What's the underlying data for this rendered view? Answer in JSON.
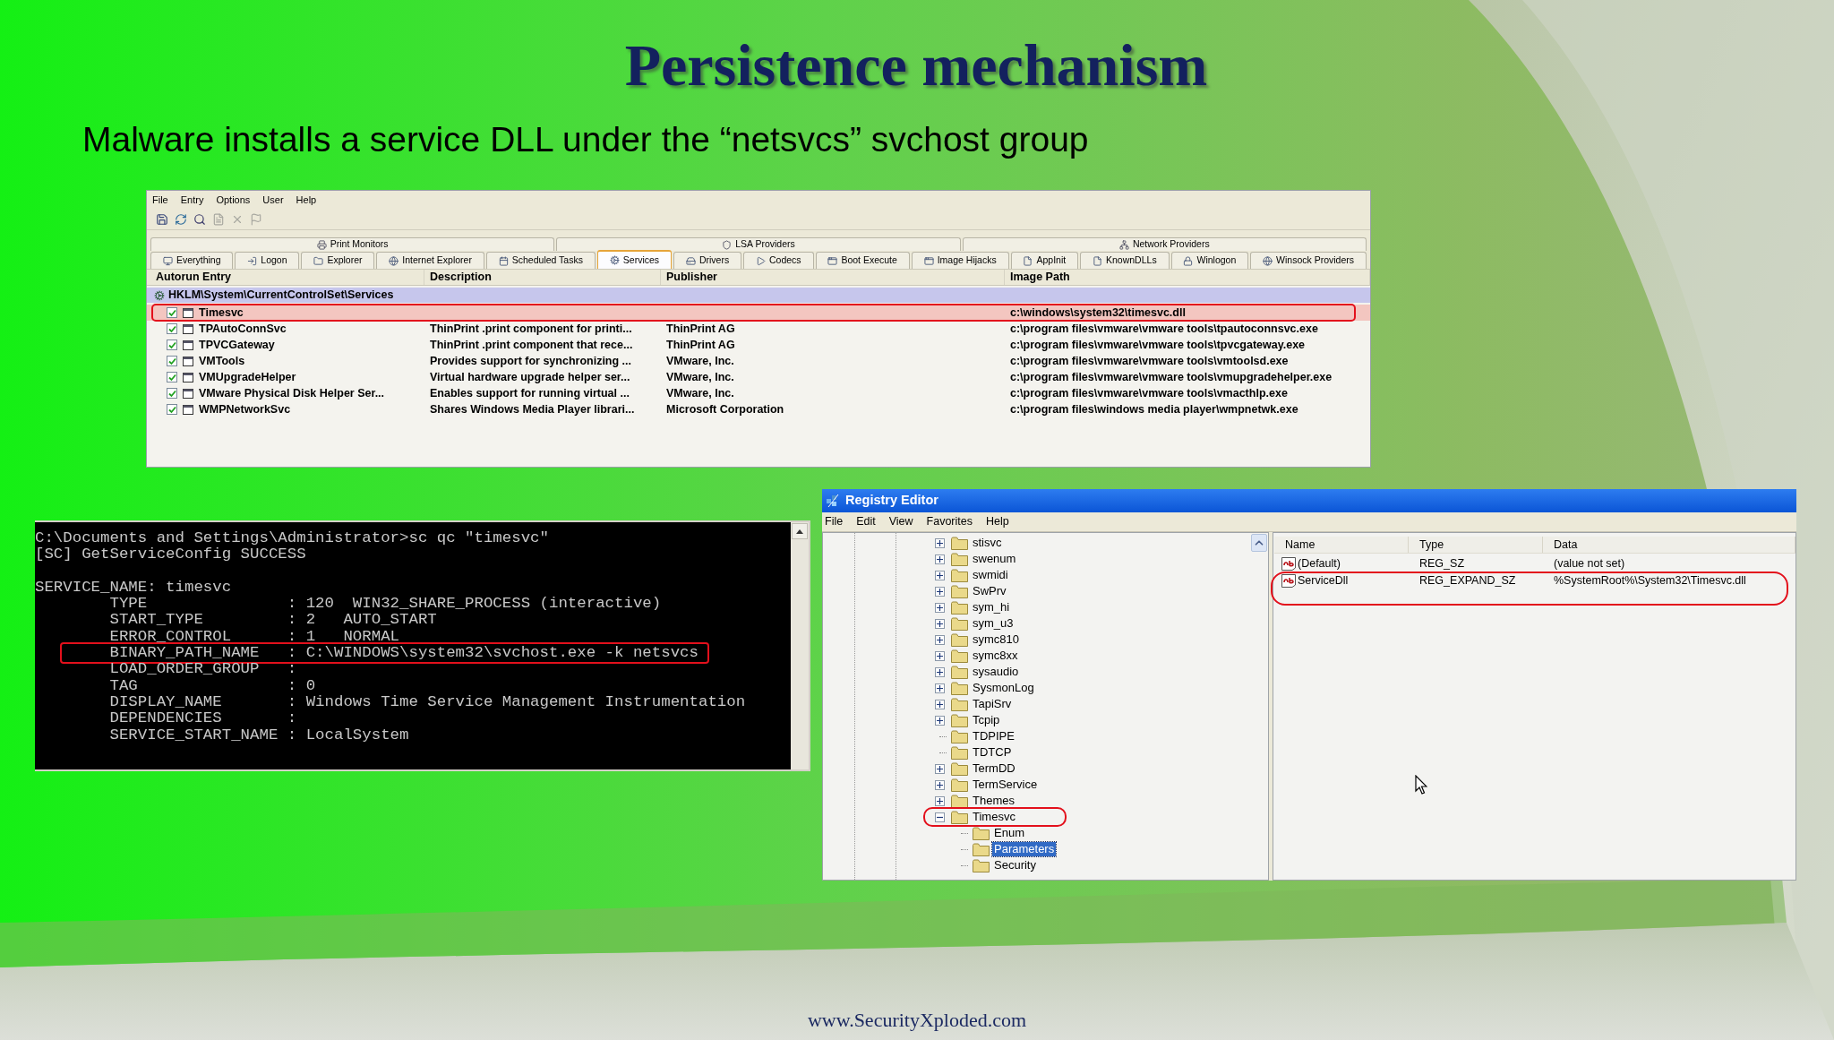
{
  "slide": {
    "title": "Persistence mechanism",
    "subtitle": "Malware installs a service DLL under the “netsvcs” svchost group",
    "footer": "www.SecurityXploded.com"
  },
  "autoruns": {
    "menu": [
      "File",
      "Entry",
      "Options",
      "User",
      "Help"
    ],
    "tab_groups": [
      "Print Monitors",
      "LSA Providers",
      "Network Providers"
    ],
    "tabs": [
      {
        "label": "Everything",
        "selected": false
      },
      {
        "label": "Logon",
        "selected": false
      },
      {
        "label": "Explorer",
        "selected": false
      },
      {
        "label": "Internet Explorer",
        "selected": false
      },
      {
        "label": "Scheduled Tasks",
        "selected": false
      },
      {
        "label": "Services",
        "selected": true
      },
      {
        "label": "Drivers",
        "selected": false
      },
      {
        "label": "Codecs",
        "selected": false
      },
      {
        "label": "Boot Execute",
        "selected": false
      },
      {
        "label": "Image Hijacks",
        "selected": false
      },
      {
        "label": "AppInit",
        "selected": false
      },
      {
        "label": "KnownDLLs",
        "selected": false
      },
      {
        "label": "Winlogon",
        "selected": false
      },
      {
        "label": "Winsock Providers",
        "selected": false
      }
    ],
    "columns": [
      "Autorun Entry",
      "Description",
      "Publisher",
      "Image Path"
    ],
    "group": "HKLM\\System\\CurrentControlSet\\Services",
    "rows": [
      {
        "entry": "Timesvc",
        "description": "",
        "publisher": "",
        "image_path": "c:\\windows\\system32\\timesvc.dll",
        "checked": true,
        "highlighted": true
      },
      {
        "entry": "TPAutoConnSvc",
        "description": "ThinPrint .print component for printi...",
        "publisher": "ThinPrint AG",
        "image_path": "c:\\program files\\vmware\\vmware tools\\tpautoconnsvc.exe",
        "checked": true,
        "highlighted": false
      },
      {
        "entry": "TPVCGateway",
        "description": "ThinPrint .print component that rece...",
        "publisher": "ThinPrint AG",
        "image_path": "c:\\program files\\vmware\\vmware tools\\tpvcgateway.exe",
        "checked": true,
        "highlighted": false
      },
      {
        "entry": "VMTools",
        "description": "Provides support for synchronizing ...",
        "publisher": "VMware, Inc.",
        "image_path": "c:\\program files\\vmware\\vmware tools\\vmtoolsd.exe",
        "checked": true,
        "highlighted": false
      },
      {
        "entry": "VMUpgradeHelper",
        "description": "Virtual hardware upgrade helper ser...",
        "publisher": "VMware, Inc.",
        "image_path": "c:\\program files\\vmware\\vmware tools\\vmupgradehelper.exe",
        "checked": true,
        "highlighted": false
      },
      {
        "entry": "VMware Physical Disk Helper Ser...",
        "description": "Enables support for running virtual ...",
        "publisher": "VMware, Inc.",
        "image_path": "c:\\program files\\vmware\\vmware tools\\vmacthlp.exe",
        "checked": true,
        "highlighted": false
      },
      {
        "entry": "WMPNetworkSvc",
        "description": "Shares Windows Media Player librari...",
        "publisher": "Microsoft Corporation",
        "image_path": "c:\\program files\\windows media player\\wmpnetwk.exe",
        "checked": true,
        "highlighted": false
      }
    ]
  },
  "console": {
    "lines": [
      {
        "text": "C:\\Documents and Settings\\Administrator>sc qc \"timesvc\"",
        "blank_before": false,
        "highlighted": false
      },
      {
        "text": "[SC] GetServiceConfig SUCCESS",
        "blank_before": false,
        "highlighted": false
      },
      {
        "text": "SERVICE_NAME: timesvc",
        "blank_before": true,
        "highlighted": false
      },
      {
        "text": "        TYPE               : 120  WIN32_SHARE_PROCESS (interactive)",
        "blank_before": false,
        "highlighted": false
      },
      {
        "text": "        START_TYPE         : 2   AUTO_START",
        "blank_before": false,
        "highlighted": false
      },
      {
        "text": "        ERROR_CONTROL      : 1   NORMAL",
        "blank_before": false,
        "highlighted": false
      },
      {
        "text": "        BINARY_PATH_NAME   : C:\\WINDOWS\\system32\\svchost.exe -k netsvcs",
        "blank_before": false,
        "highlighted": true
      },
      {
        "text": "        LOAD_ORDER_GROUP   :",
        "blank_before": false,
        "highlighted": false
      },
      {
        "text": "        TAG                : 0",
        "blank_before": false,
        "highlighted": false
      },
      {
        "text": "        DISPLAY_NAME       : Windows Time Service Management Instrumentation",
        "blank_before": false,
        "highlighted": false
      },
      {
        "text": "        DEPENDENCIES       :",
        "blank_before": false,
        "highlighted": false
      },
      {
        "text": "        SERVICE_START_NAME : LocalSystem",
        "blank_before": false,
        "highlighted": false
      }
    ]
  },
  "registry": {
    "title": "Registry Editor",
    "menu": [
      "File",
      "Edit",
      "View",
      "Favorites",
      "Help"
    ],
    "tree": [
      {
        "label": "stisvc",
        "expandable": true,
        "selected": false,
        "highlighted": false
      },
      {
        "label": "swenum",
        "expandable": true,
        "selected": false,
        "highlighted": false
      },
      {
        "label": "swmidi",
        "expandable": true,
        "selected": false,
        "highlighted": false
      },
      {
        "label": "SwPrv",
        "expandable": true,
        "selected": false,
        "highlighted": false
      },
      {
        "label": "sym_hi",
        "expandable": true,
        "selected": false,
        "highlighted": false
      },
      {
        "label": "sym_u3",
        "expandable": true,
        "selected": false,
        "highlighted": false
      },
      {
        "label": "symc810",
        "expandable": true,
        "selected": false,
        "highlighted": false
      },
      {
        "label": "symc8xx",
        "expandable": true,
        "selected": false,
        "highlighted": false
      },
      {
        "label": "sysaudio",
        "expandable": true,
        "selected": false,
        "highlighted": false
      },
      {
        "label": "SysmonLog",
        "expandable": true,
        "selected": false,
        "highlighted": false
      },
      {
        "label": "TapiSrv",
        "expandable": true,
        "selected": false,
        "highlighted": false
      },
      {
        "label": "Tcpip",
        "expandable": true,
        "selected": false,
        "highlighted": false
      },
      {
        "label": "TDPIPE",
        "expandable": false,
        "selected": false,
        "highlighted": false
      },
      {
        "label": "TDTCP",
        "expandable": false,
        "selected": false,
        "highlighted": false
      },
      {
        "label": "TermDD",
        "expandable": true,
        "selected": false,
        "highlighted": false
      },
      {
        "label": "TermService",
        "expandable": true,
        "selected": false,
        "highlighted": false
      },
      {
        "label": "Themes",
        "expandable": true,
        "selected": false,
        "highlighted": false
      },
      {
        "label": "Timesvc",
        "expandable": true,
        "expanded": true,
        "selected": false,
        "highlighted": true,
        "children": [
          {
            "label": "Enum",
            "expandable": false,
            "selected": false,
            "highlighted": false
          },
          {
            "label": "Parameters",
            "expandable": false,
            "selected": true,
            "highlighted": false
          },
          {
            "label": "Security",
            "expandable": false,
            "selected": false,
            "highlighted": false
          }
        ]
      }
    ],
    "columns": [
      "Name",
      "Type",
      "Data"
    ],
    "values": [
      {
        "name": "(Default)",
        "type": "REG_SZ",
        "data": "(value not set)",
        "highlighted": false
      },
      {
        "name": "ServiceDll",
        "type": "REG_EXPAND_SZ",
        "data": "%SystemRoot%\\System32\\Timesvc.dll",
        "highlighted": true
      }
    ]
  }
}
